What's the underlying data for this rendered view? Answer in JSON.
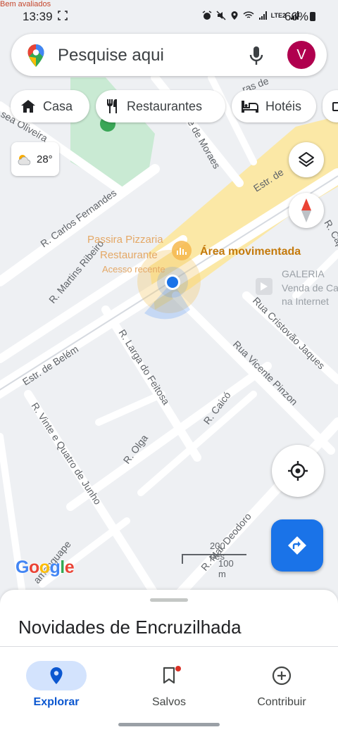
{
  "status_bar": {
    "top_note": "Bem avaliados",
    "time": "13:39",
    "battery": "66%",
    "network": "LTE2"
  },
  "search": {
    "placeholder": "Pesquise aqui",
    "avatar_letter": "V"
  },
  "chips": [
    {
      "label": "Casa",
      "icon": "home-icon"
    },
    {
      "label": "Restaurantes",
      "icon": "fork-knife-icon"
    },
    {
      "label": "Hotéis",
      "icon": "bed-icon"
    }
  ],
  "weather": {
    "temperature": "28°",
    "icon": "partly-cloudy-icon"
  },
  "map": {
    "streets": {
      "carlos_fernandes": "R. Carlos Fernandes",
      "martins_ribeiro": "R. Martins Ribeiro",
      "estr_belem": "Estr. de Belém",
      "estr_belem_partial": "Estr. de",
      "vinte_quatro_junho": "R. Vinte e Quatro de Junho",
      "larga_feitosa": "R. Larga do Feitosa",
      "olga": "R. Olga",
      "caico": "R. Caicó",
      "vicente_pinzon": "Rua Vicente Pinzon",
      "cristovao_jaques": "Rua Cristovão Jaques",
      "mal_deodoro": "R. Mal. Deodoro",
      "amanguape": "amanguape",
      "oliveira": "sea Oliveira",
      "moraes": "te de Moraes",
      "ras_de": "ras de",
      "cap": "R. Cap"
    },
    "pois": {
      "pizzaria_line1": "Passira Pizzaria",
      "pizzaria_line2": "Restaurante",
      "pizzaria_note": "Acesso recente",
      "busy_area": "Área movimentada",
      "galeria": "GALERIA",
      "galeria_sub1": "Venda de Ca",
      "galeria_sub2": "na Internet"
    },
    "scale": {
      "top": "200 pés",
      "bottom": "100 m"
    }
  },
  "logo": {
    "text": "Google"
  },
  "sheet": {
    "title": "Novidades de Encruzilhada"
  },
  "nav": [
    {
      "label": "Explorar",
      "icon": "location-pin-icon",
      "active": true
    },
    {
      "label": "Salvos",
      "icon": "bookmark-icon",
      "active": false
    },
    {
      "label": "Contribuir",
      "icon": "add-circle-icon",
      "active": false
    }
  ],
  "colors": {
    "accent": "#1a73e8",
    "avatar": "#b0004e",
    "busy": "#c47a0c"
  }
}
